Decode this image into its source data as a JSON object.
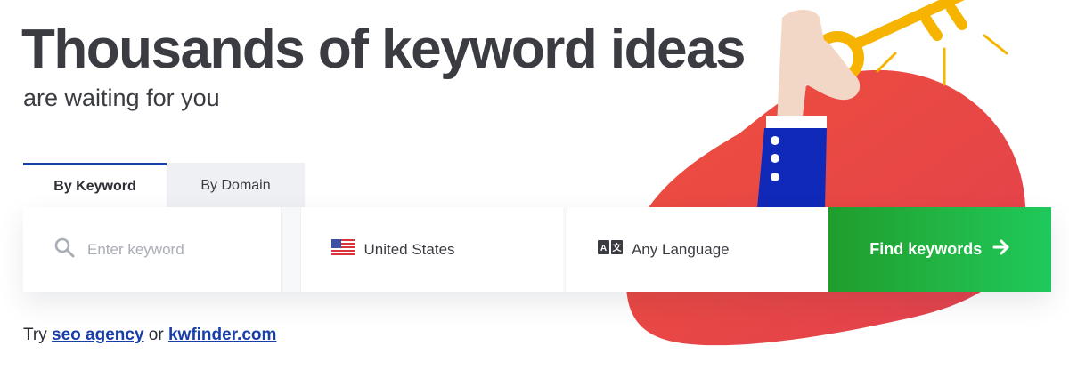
{
  "hero": {
    "title": "Thousands of keyword ideas",
    "subtitle": "are waiting for you"
  },
  "tabs": [
    {
      "label": "By Keyword",
      "active": true
    },
    {
      "label": "By Domain",
      "active": false
    }
  ],
  "search": {
    "keyword_placeholder": "Enter keyword",
    "keyword_value": "",
    "location": "United States",
    "language": "Any Language",
    "submit_label": "Find keywords"
  },
  "try_line": {
    "prefix": "Try",
    "link1": "seo agency",
    "connector": "or",
    "link2": "kwfinder.com"
  },
  "colors": {
    "accent_blue": "#1a3ea8",
    "button_green": "#22b646",
    "blob_red": "#e84c3d",
    "key_yellow": "#f6b400"
  },
  "icons": {
    "search": "search-icon",
    "flag": "us-flag-icon",
    "language": "translate-icon",
    "arrow": "arrow-right-icon"
  }
}
